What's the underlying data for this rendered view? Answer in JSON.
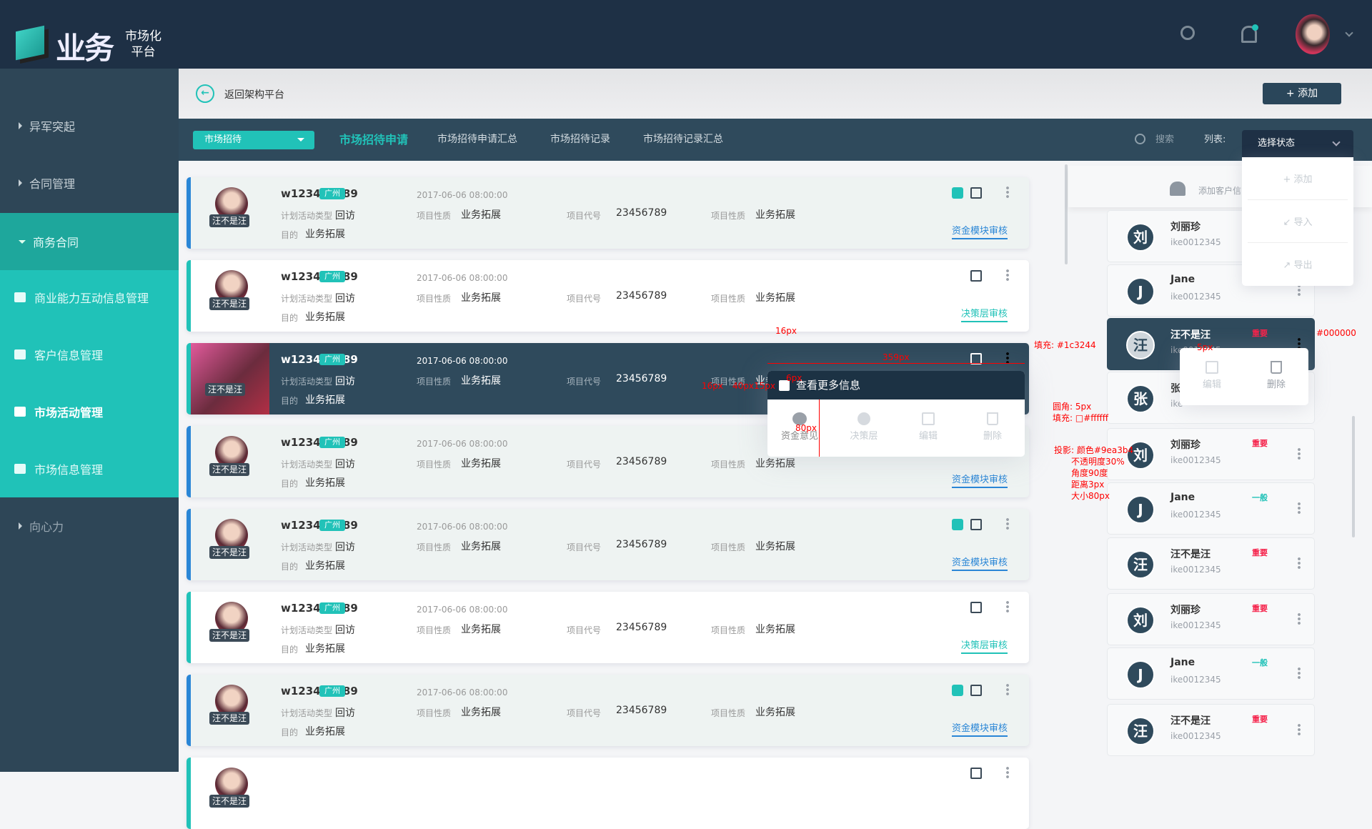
{
  "header": {
    "logo_main": "业务",
    "logo_sub1": "市场化",
    "logo_sub2": "平台",
    "icons": [
      "search-icon",
      "bell-icon",
      "avatar",
      "chevron-down-icon"
    ],
    "notification_dot_color": "#21c2b8"
  },
  "sidebar": {
    "items": [
      {
        "label": "异军突起"
      },
      {
        "label": "合同管理"
      },
      {
        "label": "商务合同",
        "expanded": true
      },
      {
        "label": "商业能力互动信息管理"
      },
      {
        "label": "客户信息管理"
      },
      {
        "label": "市场活动管理",
        "active": true
      },
      {
        "label": "市场信息管理"
      },
      {
        "label": "向心力"
      }
    ]
  },
  "backbar": {
    "label": "返回架构平台",
    "add_label": "添加"
  },
  "tabbar": {
    "select_value": "市场招待",
    "tabs": [
      "市场招待申请",
      "市场招待申请汇总",
      "市场招待记录",
      "市场招待记录汇总"
    ],
    "active_tab": 0,
    "search_label": "搜索",
    "list_label": "列表:",
    "status_select": "选择状态",
    "status_menu": [
      "添加",
      "导入",
      "导出"
    ]
  },
  "card_labels": {
    "type": "计划活动类型",
    "nature": "项目性质",
    "code": "项目代号",
    "purpose": "目的",
    "nametag": "汪不是汪"
  },
  "cards": [
    {
      "id": "w123456789",
      "city": "广州",
      "date": "2017-06-06 08:00:00",
      "type": "回访",
      "nature": "业务拓展",
      "code": "23456789",
      "nature2": "业务拓展",
      "purpose": "业务拓展",
      "link": "资金模块审核",
      "style": "blue",
      "has_link_icon": true
    },
    {
      "id": "w123456789",
      "city": "广州",
      "date": "2017-06-06 08:00:00",
      "type": "回访",
      "nature": "业务拓展",
      "code": "23456789",
      "nature2": "业务拓展",
      "purpose": "业务拓展",
      "link": "决策层审核",
      "style": "white",
      "has_link_icon": false
    },
    {
      "id": "w123456789",
      "city": "广州",
      "date": "2017-06-06 08:00:00",
      "type": "回访",
      "nature": "业务拓展",
      "code": "23456789",
      "nature2": "业务拓展",
      "purpose": "业务拓展",
      "link": "",
      "style": "dark",
      "has_link_icon": false
    },
    {
      "id": "w123456789",
      "city": "广州",
      "date": "2017-06-06 08:00:00",
      "type": "回访",
      "nature": "业务拓展",
      "code": "23456789",
      "nature2": "业务拓展",
      "purpose": "业务拓展",
      "link": "资金模块审核",
      "style": "blue",
      "has_link_icon": false
    },
    {
      "id": "w123456789",
      "city": "广州",
      "date": "2017-06-06 08:00:00",
      "type": "回访",
      "nature": "业务拓展",
      "code": "23456789",
      "nature2": "业务拓展",
      "purpose": "业务拓展",
      "link": "资金模块审核",
      "style": "blue",
      "has_link_icon": true
    },
    {
      "id": "w123456789",
      "city": "广州",
      "date": "2017-06-06 08:00:00",
      "type": "回访",
      "nature": "业务拓展",
      "code": "23456789",
      "nature2": "业务拓展",
      "purpose": "业务拓展",
      "link": "决策层审核",
      "style": "white",
      "has_link_icon": false
    },
    {
      "id": "w123456789",
      "city": "广州",
      "date": "2017-06-06 08:00:00",
      "type": "回访",
      "nature": "业务拓展",
      "code": "23456789",
      "nature2": "业务拓展",
      "purpose": "业务拓展",
      "link": "资金模块审核",
      "style": "blue",
      "has_link_icon": true
    },
    {
      "id": "",
      "city": "",
      "date": "",
      "type": "",
      "nature": "",
      "code": "",
      "nature2": "",
      "purpose": "",
      "link": "",
      "style": "white",
      "has_link_icon": false
    }
  ],
  "card_popup": {
    "title": "查看更多信息",
    "actions": [
      "资金意见",
      "决策层",
      "编辑",
      "删除"
    ]
  },
  "right_panel": {
    "add_customer": "添加客户信息",
    "items": [
      {
        "initial": "刘",
        "name": "刘丽珍",
        "id": "ike0012345",
        "tag": ""
      },
      {
        "initial": "J",
        "name": "Jane",
        "id": "ike0012345",
        "tag": ""
      },
      {
        "initial": "汪",
        "name": "汪不是汪",
        "id": "ike0012345",
        "tag": "重要",
        "active": true
      },
      {
        "initial": "张",
        "name": "张",
        "id": "ike",
        "tag": ""
      },
      {
        "initial": "刘",
        "name": "刘丽珍",
        "id": "ike0012345",
        "tag": "重要"
      },
      {
        "initial": "J",
        "name": "Jane",
        "id": "ike0012345",
        "tag": "一般"
      },
      {
        "initial": "汪",
        "name": "汪不是汪",
        "id": "ike0012345",
        "tag": "重要"
      },
      {
        "initial": "刘",
        "name": "刘丽珍",
        "id": "ike0012345",
        "tag": "重要"
      },
      {
        "initial": "J",
        "name": "Jane",
        "id": "ike0012345",
        "tag": "一般"
      },
      {
        "initial": "汪",
        "name": "汪不是汪",
        "id": "ike0012345",
        "tag": "重要"
      }
    ],
    "item_popup": [
      "编辑",
      "删除"
    ],
    "tag_colors": {
      "重要": "#f5224a",
      "一般": "#21c2b8"
    }
  },
  "annotations": {
    "w16a": "16px",
    "w359": "359px",
    "w6": "6px",
    "h16": "16px",
    "w40": "40px",
    "w15": "15px",
    "h80": "80px",
    "fill_label": "填充: #1c3244",
    "fill_label2": "#1c3244",
    "black": "#000000",
    "gap5": "5px",
    "radius": "圆角: 5px",
    "fill_white": "填充: □#ffffff",
    "shadow": [
      "投影: 颜色#9ea3b4",
      "不透明度30%",
      "角度90度",
      "距离3px",
      "大小80px"
    ]
  },
  "colors": {
    "topbar": "#1e3045",
    "sidebar": "#2e4657",
    "accent": "#21c2b8",
    "link_blue": "#2a86d6",
    "popup_header": "#1c3244"
  }
}
